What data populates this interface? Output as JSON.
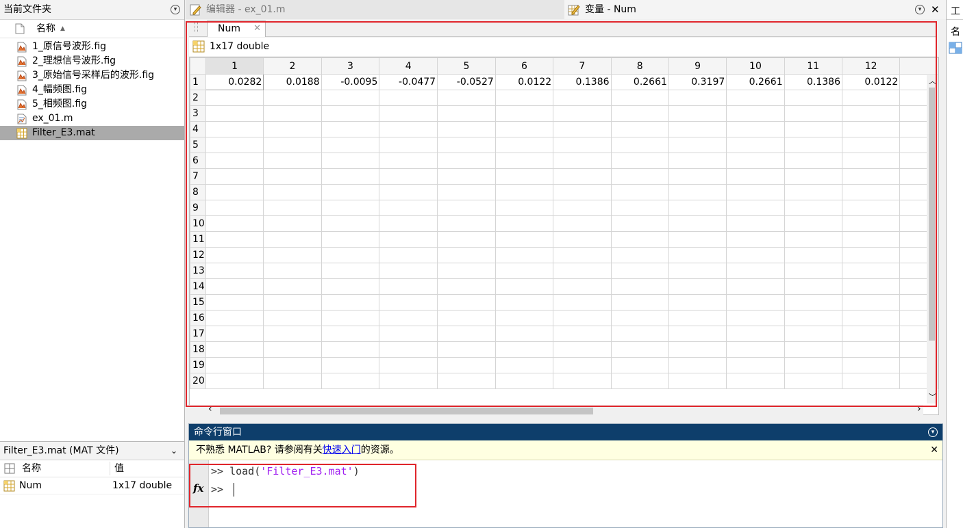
{
  "current_folder": {
    "title": "当前文件夹",
    "column_name": "名称",
    "files": [
      {
        "name": "1_原信号波形.fig",
        "type": "fig"
      },
      {
        "name": "2_理想信号波形.fig",
        "type": "fig"
      },
      {
        "name": "3_原始信号采样后的波形.fig",
        "type": "fig"
      },
      {
        "name": "4_幅频图.fig",
        "type": "fig"
      },
      {
        "name": "5_相频图.fig",
        "type": "fig"
      },
      {
        "name": "ex_01.m",
        "type": "m"
      },
      {
        "name": "Filter_E3.mat",
        "type": "mat",
        "selected": true
      }
    ]
  },
  "details": {
    "title": "Filter_E3.mat  (MAT 文件)",
    "col_name": "名称",
    "col_value": "值",
    "rows": [
      {
        "name": "Num",
        "value": "1x17 double"
      }
    ]
  },
  "tabs": {
    "editor": "编辑器 - ex_01.m",
    "variables": "变量 - Num"
  },
  "variable": {
    "tab_label": "Num",
    "info": "1x17 double",
    "columns": [
      "1",
      "2",
      "3",
      "4",
      "5",
      "6",
      "7",
      "8",
      "9",
      "10",
      "11",
      "12"
    ],
    "row_labels": [
      "1",
      "2",
      "3",
      "4",
      "5",
      "6",
      "7",
      "8",
      "9",
      "10",
      "11",
      "12",
      "13",
      "14",
      "15",
      "16",
      "17",
      "18",
      "19",
      "20"
    ],
    "row1_values": [
      "0.0282",
      "0.0188",
      "-0.0095",
      "-0.0477",
      "-0.0527",
      "0.0122",
      "0.1386",
      "0.2661",
      "0.3197",
      "0.2661",
      "0.1386",
      "0.0122"
    ]
  },
  "command_window": {
    "title": "命令行窗口",
    "notice_prefix": "不熟悉 MATLAB? 请参阅有关",
    "notice_link": "快速入门",
    "notice_suffix": "的资源。",
    "history_prompt": ">>",
    "history_func": "load(",
    "history_arg": "'Filter_E3.mat'",
    "history_close": ")",
    "prompt": ">>",
    "fx": "fx"
  },
  "workspace": {
    "title_partial": "工",
    "col_partial": "名"
  },
  "colors": {
    "highlight_box": "#e0252b",
    "command_title_bg": "#0e3e6b",
    "notice_bg": "#ffffe1",
    "string_color": "#a020f0"
  }
}
